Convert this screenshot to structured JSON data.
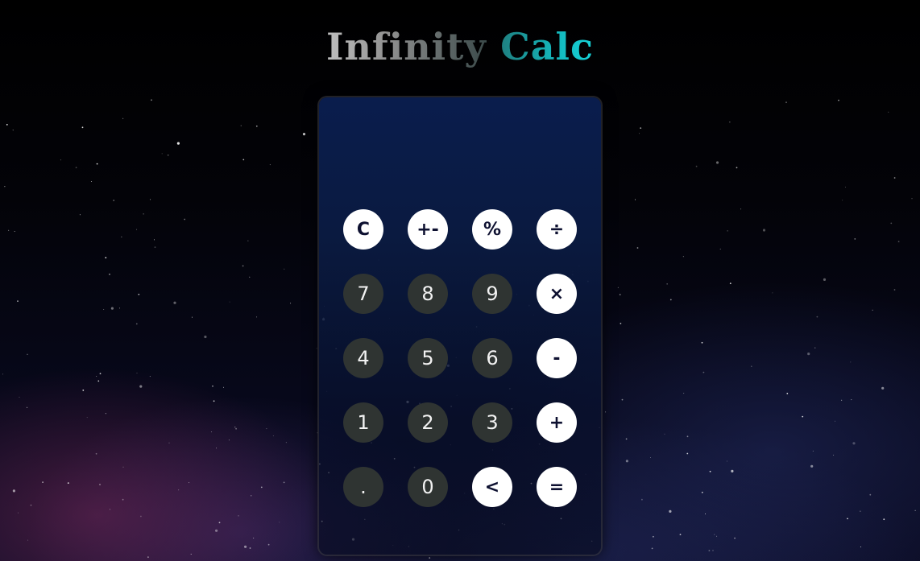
{
  "title": {
    "word1": "Infinity",
    "word2": "Calc"
  },
  "display": {
    "value": ""
  },
  "keys": [
    {
      "label": "C",
      "style": "light",
      "name": "clear-button"
    },
    {
      "label": "+-",
      "style": "light",
      "name": "plus-minus-button"
    },
    {
      "label": "%",
      "style": "light",
      "name": "percent-button"
    },
    {
      "label": "÷",
      "style": "light",
      "name": "divide-button"
    },
    {
      "label": "7",
      "style": "dark",
      "name": "digit-7-button"
    },
    {
      "label": "8",
      "style": "dark",
      "name": "digit-8-button"
    },
    {
      "label": "9",
      "style": "dark",
      "name": "digit-9-button"
    },
    {
      "label": "×",
      "style": "light",
      "name": "multiply-button"
    },
    {
      "label": "4",
      "style": "dark",
      "name": "digit-4-button"
    },
    {
      "label": "5",
      "style": "dark",
      "name": "digit-5-button"
    },
    {
      "label": "6",
      "style": "dark",
      "name": "digit-6-button"
    },
    {
      "label": "-",
      "style": "light",
      "name": "subtract-button"
    },
    {
      "label": "1",
      "style": "dark",
      "name": "digit-1-button"
    },
    {
      "label": "2",
      "style": "dark",
      "name": "digit-2-button"
    },
    {
      "label": "3",
      "style": "dark",
      "name": "digit-3-button"
    },
    {
      "label": "+",
      "style": "light",
      "name": "add-button"
    },
    {
      "label": ".",
      "style": "dark",
      "name": "decimal-button"
    },
    {
      "label": "0",
      "style": "dark",
      "name": "digit-0-button"
    },
    {
      "label": "<",
      "style": "light",
      "name": "backspace-button"
    },
    {
      "label": "=",
      "style": "light",
      "name": "equals-button"
    }
  ],
  "colors": {
    "key_light": "#ffffff",
    "key_dark": "#2f3432",
    "panel": "#0a1d4d",
    "title_accent": "#16c4c9"
  }
}
